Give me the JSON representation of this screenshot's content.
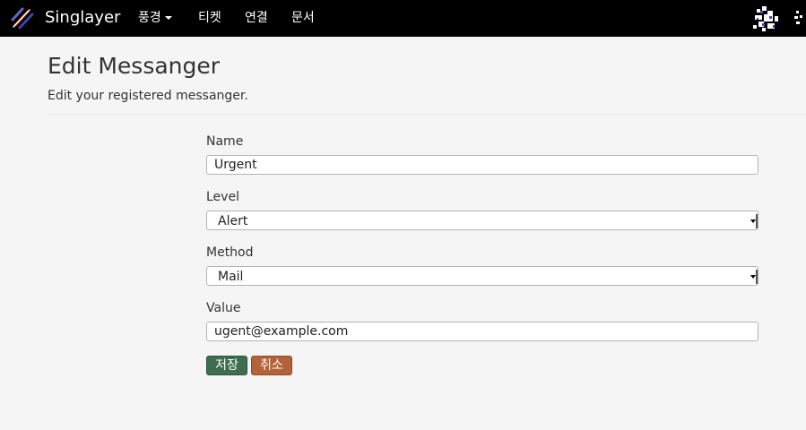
{
  "navbar": {
    "brand": "Singlayer",
    "items": [
      {
        "label": "풍경",
        "has_caret": true
      },
      {
        "label": "티켓"
      },
      {
        "label": "연결"
      },
      {
        "label": "문서"
      }
    ]
  },
  "header": {
    "title": "Edit Messanger",
    "subtitle": "Edit your registered messanger."
  },
  "form": {
    "name": {
      "label": "Name",
      "value": "Urgent"
    },
    "level": {
      "label": "Level",
      "selected": "Alert"
    },
    "method": {
      "label": "Method",
      "selected": "Mail"
    },
    "value": {
      "label": "Value",
      "value": "ugent@example.com"
    },
    "save_label": "저장",
    "cancel_label": "취소"
  },
  "colors": {
    "navbar_bg": "#000000",
    "page_bg": "#f5f5f5",
    "save_button": "#3f6d52",
    "cancel_button": "#b3633a"
  },
  "icons": {
    "brand": "singlayer-logo-icon",
    "user": "user-avatar"
  }
}
